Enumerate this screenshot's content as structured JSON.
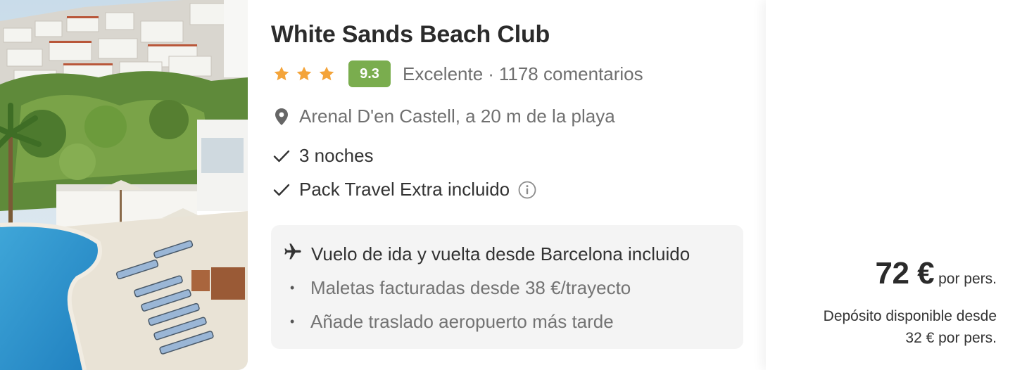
{
  "hotel": {
    "image_alt": "White Sands Beach Club photo",
    "name": "White Sands Beach Club",
    "stars": 3,
    "score": "9.3",
    "rating_label": "Excelente",
    "separator": "·",
    "reviews": "1178 comentarios",
    "location": "Arenal D'en Castell, a 20 m de la playa"
  },
  "features": {
    "nights": "3 noches",
    "pack": "Pack Travel Extra incluido"
  },
  "flight": {
    "main": "Vuelo de ida y vuelta desde Barcelona incluido",
    "extras": [
      "Maletas facturadas desde 38 €/trayecto",
      "Añade traslado aeropuerto más tarde"
    ]
  },
  "price": {
    "amount": "72 €",
    "per": "por pers.",
    "deposit_line1": "Depósito disponible desde",
    "deposit_line2": "32 € por pers."
  },
  "icons": {
    "star": "star-icon",
    "location": "location-pin-icon",
    "check": "check-icon",
    "info": "info-icon",
    "plane": "airplane-icon"
  },
  "colors": {
    "star": "#f4a43a",
    "score_bg": "#7aad4e",
    "flight_box_bg": "#f4f4f4"
  }
}
